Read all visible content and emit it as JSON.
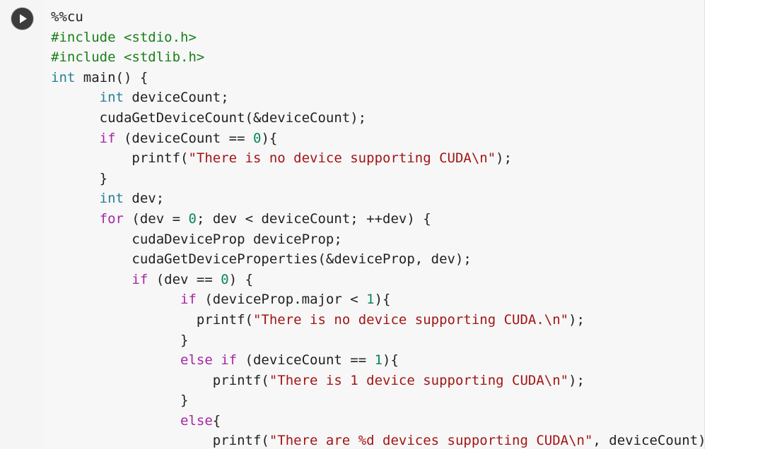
{
  "cell": {
    "run_label": "Run cell",
    "lines": [
      [
        {
          "t": "plain",
          "v": "%%cu"
        }
      ],
      [
        {
          "t": "pre",
          "v": "#include <stdio.h>"
        }
      ],
      [
        {
          "t": "pre",
          "v": "#include <stdlib.h>"
        }
      ],
      [
        {
          "t": "type",
          "v": "int"
        },
        {
          "t": "plain",
          "v": " main() {"
        }
      ],
      [
        {
          "t": "plain",
          "v": "      "
        },
        {
          "t": "type",
          "v": "int"
        },
        {
          "t": "plain",
          "v": " deviceCount;"
        }
      ],
      [
        {
          "t": "plain",
          "v": "      cudaGetDeviceCount(&deviceCount);"
        }
      ],
      [
        {
          "t": "plain",
          "v": "      "
        },
        {
          "t": "kw",
          "v": "if"
        },
        {
          "t": "plain",
          "v": " (deviceCount == "
        },
        {
          "t": "num",
          "v": "0"
        },
        {
          "t": "plain",
          "v": "){"
        }
      ],
      [
        {
          "t": "plain",
          "v": "          printf("
        },
        {
          "t": "str",
          "v": "\"There is no device supporting CUDA\\n\""
        },
        {
          "t": "plain",
          "v": ");"
        }
      ],
      [
        {
          "t": "plain",
          "v": "      }"
        }
      ],
      [
        {
          "t": "plain",
          "v": "      "
        },
        {
          "t": "type",
          "v": "int"
        },
        {
          "t": "plain",
          "v": " dev;"
        }
      ],
      [
        {
          "t": "plain",
          "v": "      "
        },
        {
          "t": "kw",
          "v": "for"
        },
        {
          "t": "plain",
          "v": " (dev = "
        },
        {
          "t": "num",
          "v": "0"
        },
        {
          "t": "plain",
          "v": "; dev < deviceCount; ++dev) {"
        }
      ],
      [
        {
          "t": "plain",
          "v": "          cudaDeviceProp deviceProp;"
        }
      ],
      [
        {
          "t": "plain",
          "v": "          cudaGetDeviceProperties(&deviceProp, dev);"
        }
      ],
      [
        {
          "t": "plain",
          "v": "          "
        },
        {
          "t": "kw",
          "v": "if"
        },
        {
          "t": "plain",
          "v": " (dev == "
        },
        {
          "t": "num",
          "v": "0"
        },
        {
          "t": "plain",
          "v": ") {"
        }
      ],
      [
        {
          "t": "plain",
          "v": "                "
        },
        {
          "t": "kw",
          "v": "if"
        },
        {
          "t": "plain",
          "v": " (deviceProp.major < "
        },
        {
          "t": "num",
          "v": "1"
        },
        {
          "t": "plain",
          "v": "){"
        }
      ],
      [
        {
          "t": "plain",
          "v": "                  printf("
        },
        {
          "t": "str",
          "v": "\"There is no device supporting CUDA.\\n\""
        },
        {
          "t": "plain",
          "v": ");"
        }
      ],
      [
        {
          "t": "plain",
          "v": "                }"
        }
      ],
      [
        {
          "t": "plain",
          "v": "                "
        },
        {
          "t": "kw",
          "v": "else if"
        },
        {
          "t": "plain",
          "v": " (deviceCount == "
        },
        {
          "t": "num",
          "v": "1"
        },
        {
          "t": "plain",
          "v": "){"
        }
      ],
      [
        {
          "t": "plain",
          "v": "                    printf("
        },
        {
          "t": "str",
          "v": "\"There is 1 device supporting CUDA\\n\""
        },
        {
          "t": "plain",
          "v": ");"
        }
      ],
      [
        {
          "t": "plain",
          "v": "                }"
        }
      ],
      [
        {
          "t": "plain",
          "v": "                "
        },
        {
          "t": "kw",
          "v": "else"
        },
        {
          "t": "plain",
          "v": "{"
        }
      ],
      [
        {
          "t": "plain",
          "v": "                    printf("
        },
        {
          "t": "str",
          "v": "\"There are %d devices supporting CUDA\\n\""
        },
        {
          "t": "plain",
          "v": ", deviceCount);"
        }
      ]
    ]
  },
  "colors": {
    "preprocessor": "#1a7f1a",
    "type": "#267f99",
    "keyword": "#a626a4",
    "number": "#098658",
    "string": "#a31515",
    "text": "#212121"
  },
  "icons": {
    "run": "play-icon"
  }
}
